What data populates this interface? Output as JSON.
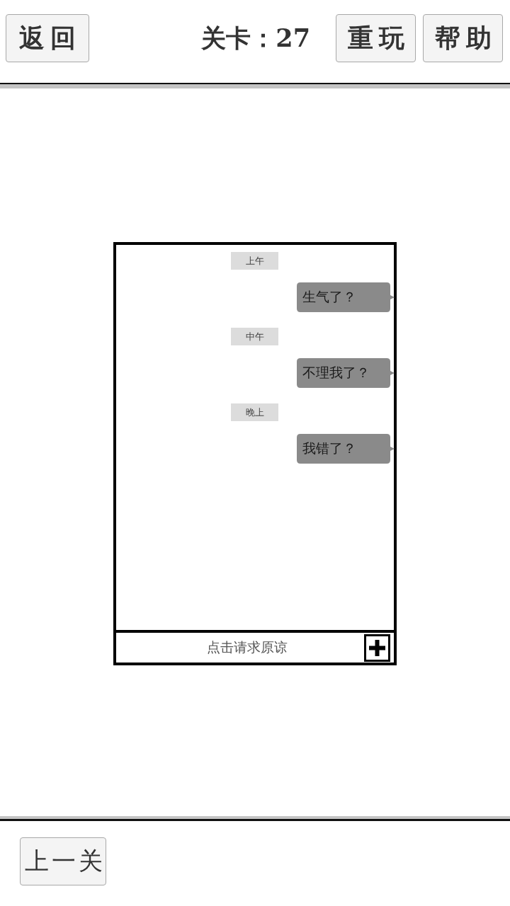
{
  "header": {
    "back_button": "返回",
    "level": "关卡：27",
    "replay_button": "重玩",
    "help_button": "帮助"
  },
  "chat": {
    "messages": [
      {
        "kind": "time",
        "text": "上午"
      },
      {
        "kind": "bubble",
        "text": "生气了？"
      },
      {
        "kind": "time",
        "text": "中午"
      },
      {
        "kind": "bubble",
        "text": "不理我了？"
      },
      {
        "kind": "time",
        "text": "晚上"
      },
      {
        "kind": "bubble",
        "text": "我错了？"
      }
    ],
    "request_button": "点击请求原谅"
  },
  "footer": {
    "prev_button": "上一关"
  }
}
